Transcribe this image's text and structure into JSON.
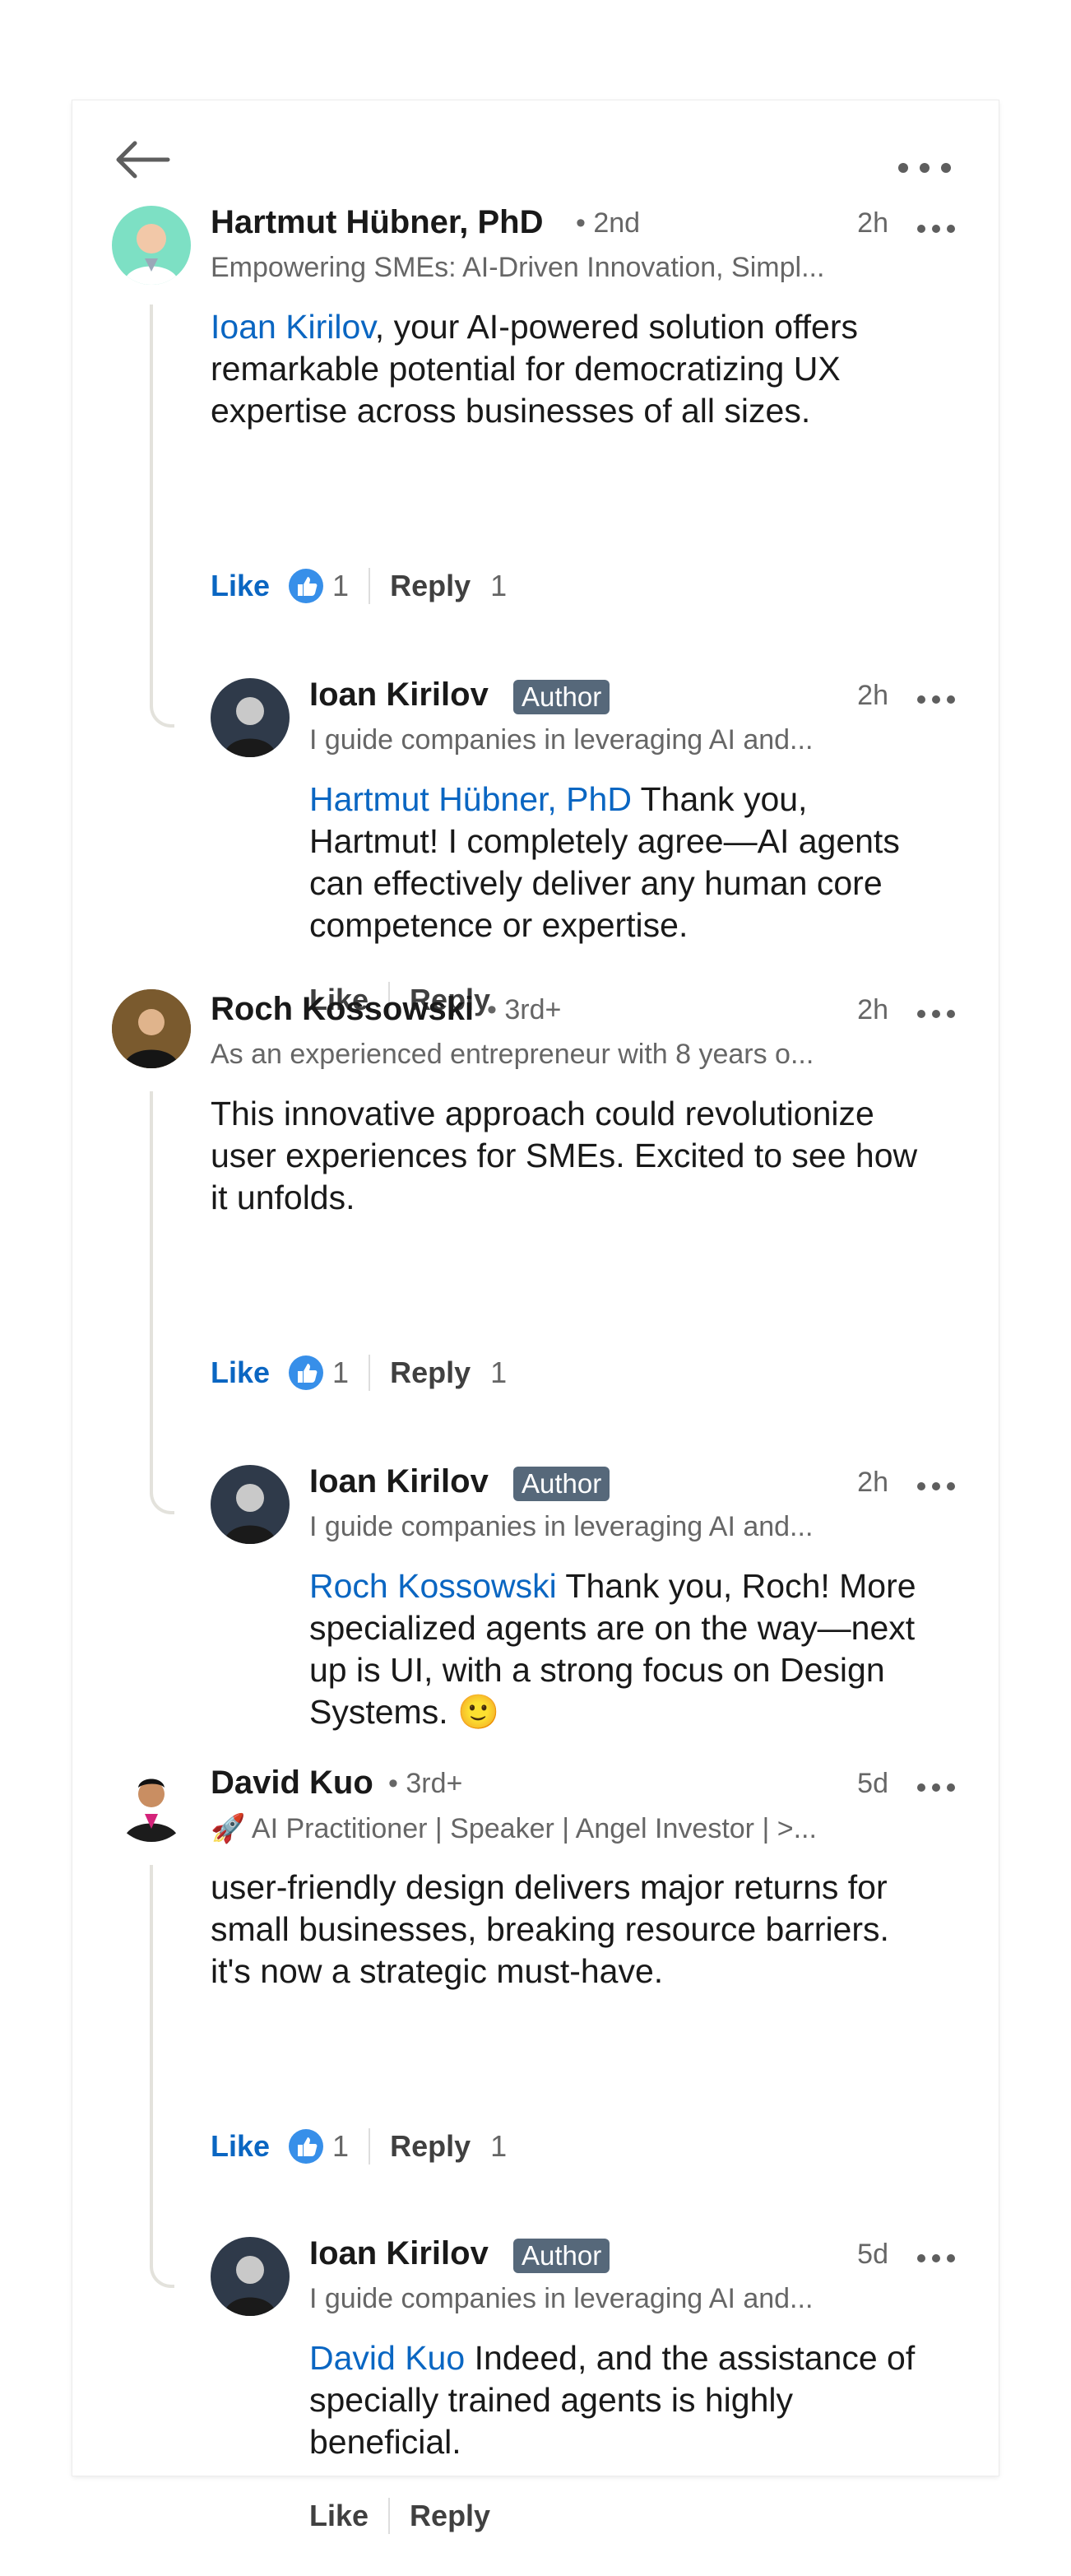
{
  "topbar": {
    "back_icon": "arrow-left-icon",
    "more_icon": "ellipsis-icon"
  },
  "comments": [
    {
      "author": "Hartmut Hübner, PhD",
      "degree": "• 2nd",
      "time": "2h",
      "headline": "Empowering SMEs: AI-Driven Innovation, Simpl...",
      "mention": "Ioan Kirilov",
      "text_lines": [
        ", your AI-powered solution offers",
        "remarkable potential for democratizing UX",
        "expertise across businesses of all sizes."
      ],
      "like_label": "Like",
      "like_count": "1",
      "reply_label": "Reply",
      "reply_count": "1",
      "reply": {
        "author": "Ioan Kirilov",
        "badge": "Author",
        "time": "2h",
        "headline": "I guide companies in leveraging AI and...",
        "mention": "Hartmut Hübner, PhD",
        "text_lines": [
          " Thank you,",
          "Hartmut! I completely agree—AI agents",
          "can effectively deliver any human core",
          "competence or expertise."
        ],
        "like_label": "Like",
        "reply_label": "Reply"
      }
    },
    {
      "author": "Roch Kossowski",
      "degree": "• 3rd+",
      "time": "2h",
      "headline": "As an experienced entrepreneur with 8 years o...",
      "text_lines": [
        "This innovative approach could revolutionize",
        "user experiences for SMEs. Excited to see how",
        "it unfolds."
      ],
      "like_label": "Like",
      "like_count": "1",
      "reply_label": "Reply",
      "reply_count": "1",
      "reply": {
        "author": "Ioan Kirilov",
        "badge": "Author",
        "time": "2h",
        "headline": "I guide companies in leveraging AI and...",
        "mention": "Roch Kossowski",
        "text_lines": [
          " Thank you, Roch! More",
          "specialized agents are on the way—next",
          "up is UI, with a strong focus on Design",
          "Systems. 🙂"
        ]
      }
    },
    {
      "author": "David Kuo",
      "degree": "• 3rd+",
      "time": "5d",
      "headline": "🚀 AI Practitioner | Speaker | Angel Investor | >...",
      "text_lines": [
        "user-friendly design delivers major returns for",
        "small businesses, breaking resource barriers.",
        "it's now a strategic must-have."
      ],
      "like_label": "Like",
      "like_count": "1",
      "reply_label": "Reply",
      "reply_count": "1",
      "reply": {
        "author": "Ioan Kirilov",
        "badge": "Author",
        "time": "5d",
        "headline": "I guide companies in leveraging AI and...",
        "mention": "David Kuo",
        "text_lines": [
          " Indeed, and the assistance of",
          "specially trained agents is highly",
          "beneficial."
        ],
        "like_label": "Like",
        "reply_label": "Reply"
      }
    }
  ],
  "colors": {
    "link": "#0a66c2",
    "badge": "#56687a",
    "thread_line": "#e3e2dc"
  }
}
